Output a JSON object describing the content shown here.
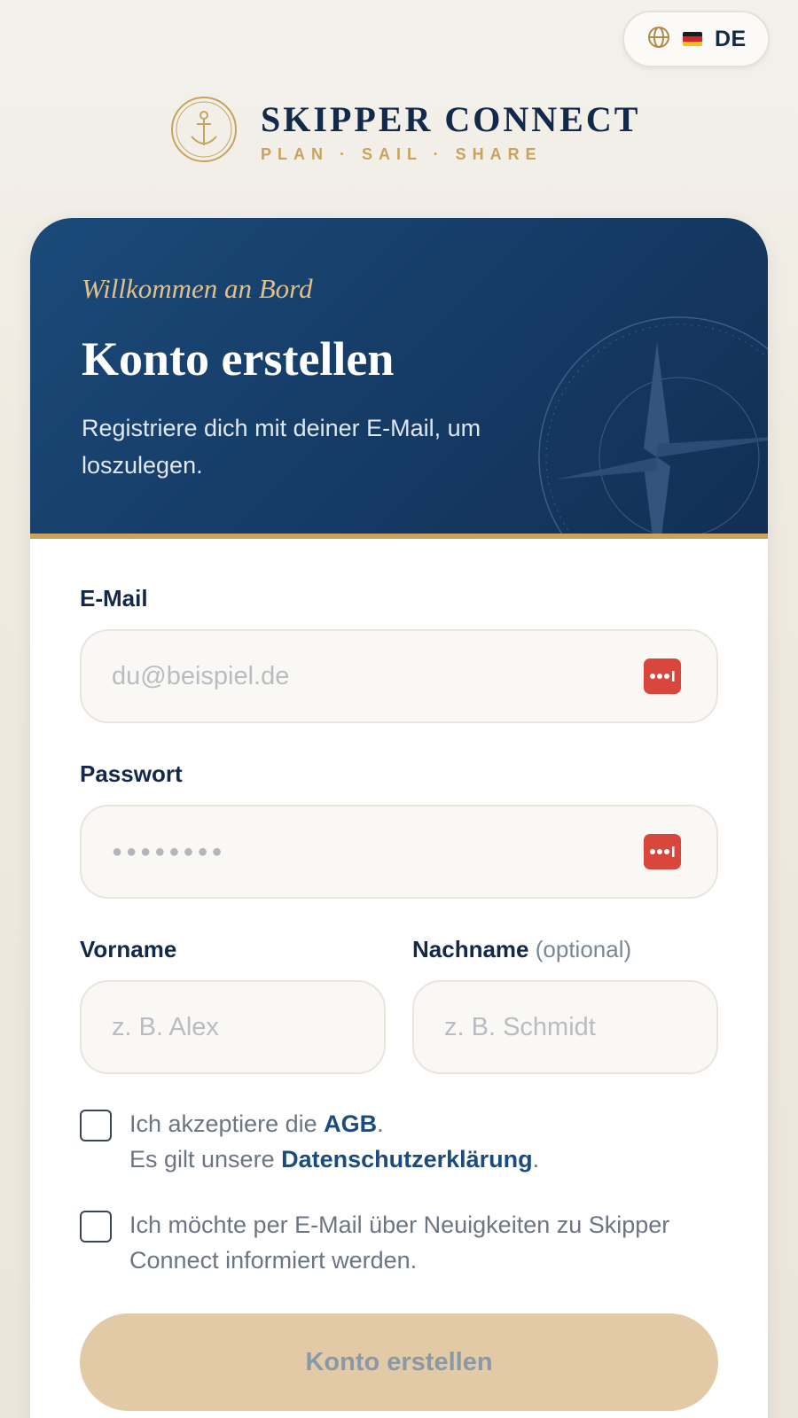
{
  "language": {
    "code": "DE",
    "globe_icon": "globe-icon",
    "flag_icon": "german-flag-icon"
  },
  "brand": {
    "name": "SKIPPER CONNECT",
    "tagline": "PLAN · SAIL · SHARE",
    "logo_icon": "anchor-icon"
  },
  "header": {
    "welcome": "Willkommen an Bord",
    "title": "Konto erstellen",
    "subtitle": "Registriere dich mit deiner E-Mail, um loszulegen."
  },
  "form": {
    "email": {
      "label": "E-Mail",
      "placeholder": "du@beispiel.de"
    },
    "password": {
      "label": "Passwort",
      "placeholder_dots": "●●●●●●●●"
    },
    "first_name": {
      "label": "Vorname",
      "placeholder": "z. B. Alex"
    },
    "last_name": {
      "label": "Nachname",
      "optional": "(optional)",
      "placeholder": "z. B. Schmidt"
    },
    "terms": {
      "prefix": "Ich akzeptiere die ",
      "agb_link": "AGB",
      "suffix": ".",
      "line2_prefix": "Es gilt unsere ",
      "privacy_link": "Datenschutzerklärung",
      "line2_suffix": "."
    },
    "newsletter": {
      "text": "Ich möchte per E-Mail über Neuigkeiten zu Skipper Connect informiert werden."
    },
    "submit_label": "Konto erstellen"
  },
  "colors": {
    "navy": "#13294b",
    "gold": "#c9a35c",
    "password_manager": "#d9463c",
    "submit_disabled": "#e1caa5"
  }
}
